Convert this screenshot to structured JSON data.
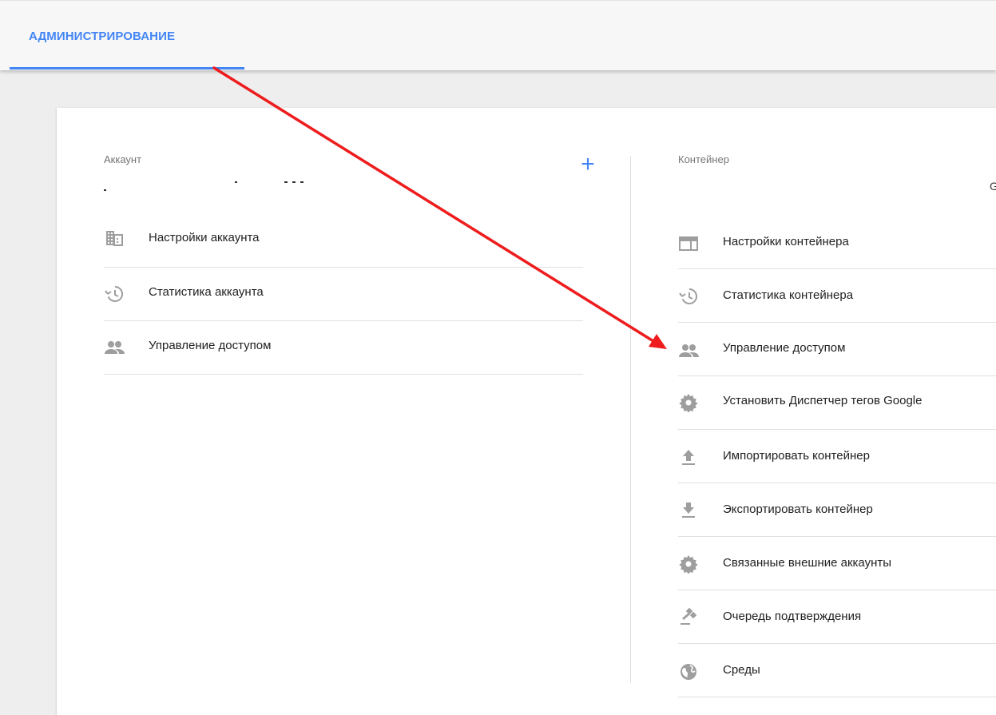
{
  "header": {
    "tab_label": "АДМИНИСТРИРОВАНИЕ"
  },
  "account": {
    "section_label": "Аккаунт",
    "add_label": "+",
    "items": [
      {
        "label": "Настройки аккаунта",
        "icon": "building-icon"
      },
      {
        "label": "Статистика аккаунта",
        "icon": "history-icon"
      },
      {
        "label": "Управление доступом",
        "icon": "people-icon"
      }
    ]
  },
  "container": {
    "section_label": "Контейнер",
    "container_id_fragment": "G",
    "items": [
      {
        "label": "Настройки контейнера",
        "icon": "web-layout-icon"
      },
      {
        "label": "Статистика контейнера",
        "icon": "history-icon"
      },
      {
        "label": "Управление доступом",
        "icon": "people-icon"
      },
      {
        "label": "Установить Диспетчер тегов Google",
        "icon": "gear-icon"
      },
      {
        "label": "Импортировать контейнер",
        "icon": "upload-icon"
      },
      {
        "label": "Экспортировать контейнер",
        "icon": "download-icon"
      },
      {
        "label": "Связанные внешние аккаунты",
        "icon": "gear-icon"
      },
      {
        "label": "Очередь подтверждения",
        "icon": "gavel-icon"
      },
      {
        "label": "Среды",
        "icon": "globe-icon"
      }
    ]
  },
  "colors": {
    "accent": "#4285f4",
    "icon_gray": "#9e9e9e",
    "annotation_arrow": "#ee1c1c"
  }
}
